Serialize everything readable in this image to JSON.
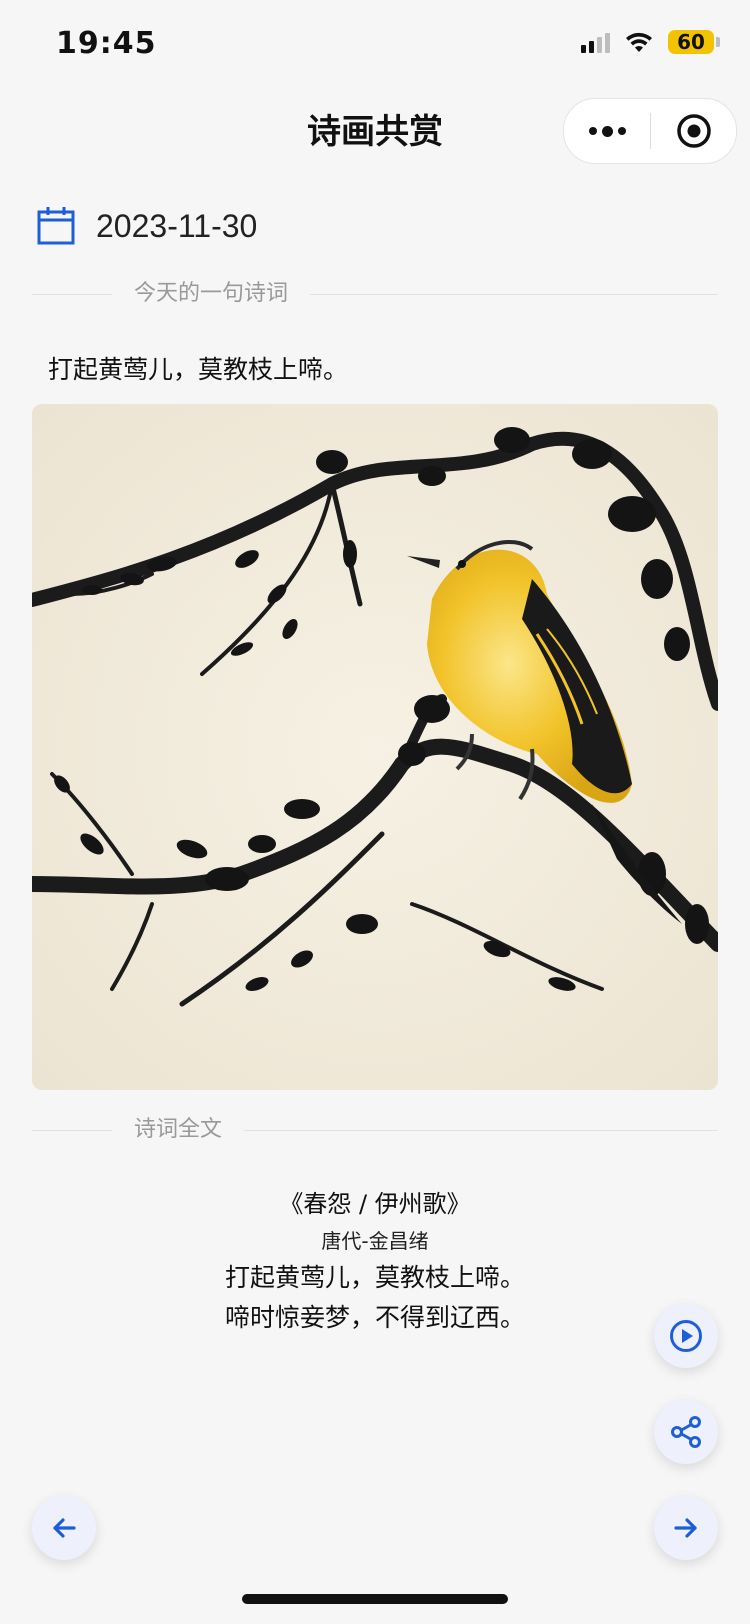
{
  "status_bar": {
    "time": "19:45",
    "battery": "60"
  },
  "nav": {
    "title": "诗画共赏"
  },
  "date": "2023-11-30",
  "daily_section": {
    "label": "今天的一句诗词",
    "line": "打起黄莺儿，莫教枝上啼。"
  },
  "full_section": {
    "label": "诗词全文"
  },
  "poem": {
    "title": "《春怨 / 伊州歌》",
    "author": "唐代-金昌绪",
    "lines": [
      "打起黄莺儿，莫教枝上啼。",
      "啼时惊妾梦，不得到辽西。"
    ]
  },
  "colors": {
    "accent": "#1f5fd6",
    "background": "#f6f6f6",
    "fab_background": "#eef0fb",
    "battery": "#f2c400"
  },
  "icons": {
    "date": "calendar-icon",
    "play": "play-circle-icon",
    "share": "share-icon",
    "prev": "arrow-left-icon",
    "next": "arrow-right-icon"
  }
}
